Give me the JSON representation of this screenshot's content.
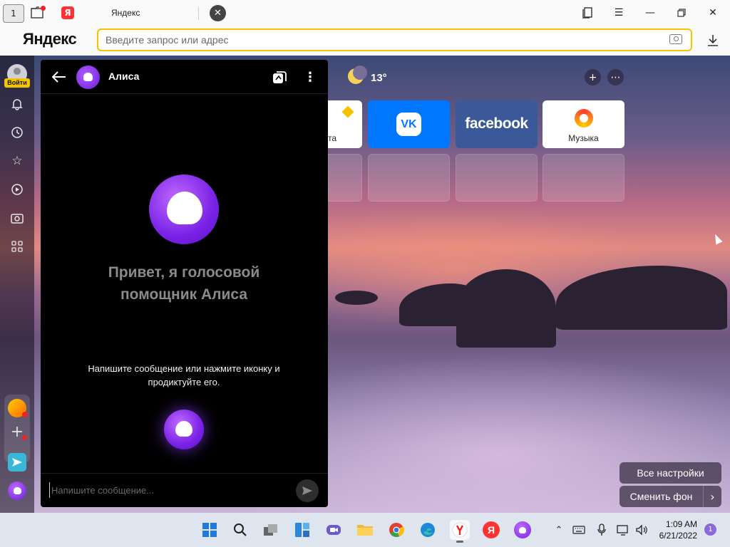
{
  "window": {
    "tab_counter": "1",
    "tab_title": "Яндекс",
    "tab_favicon": "Я"
  },
  "addressbar": {
    "logo": "Яндекс",
    "placeholder": "Введите запрос или адрес"
  },
  "sidebar": {
    "login_label": "Войти",
    "icons": [
      "bell-icon",
      "history-icon",
      "star-icon",
      "play-icon",
      "camera-icon",
      "apps-icon"
    ]
  },
  "alice": {
    "title": "Алиса",
    "greeting": "Привет, я голосовой помощник Алиса",
    "hint": "Напишите сообщение или нажмите иконку и продиктуйте его.",
    "input_placeholder": "Напишите сообщение..."
  },
  "newtab": {
    "weather_temp": "13°",
    "tiles": [
      {
        "label": "та",
        "kind": "partial"
      },
      {
        "label": "VK",
        "kind": "vk"
      },
      {
        "label": "facebook",
        "kind": "facebook"
      },
      {
        "label": "Музыка",
        "kind": "music"
      }
    ],
    "all_settings": "Все настройки",
    "change_bg": "Сменить фон"
  },
  "taskbar": {
    "time": "1:09 AM",
    "date": "6/21/2022",
    "notification_count": "1",
    "apps": [
      "windows-start-icon",
      "search-icon",
      "task-view-icon",
      "widgets-icon",
      "chat-icon",
      "file-explorer-icon",
      "chrome-icon",
      "edge-icon",
      "yandex-browser-icon",
      "yandex-icon",
      "alice-icon"
    ]
  },
  "colors": {
    "accent": "#f6c300",
    "alice_purple": "#7a22e6",
    "vk_blue": "#0077ff",
    "facebook_blue": "#3b5998"
  }
}
